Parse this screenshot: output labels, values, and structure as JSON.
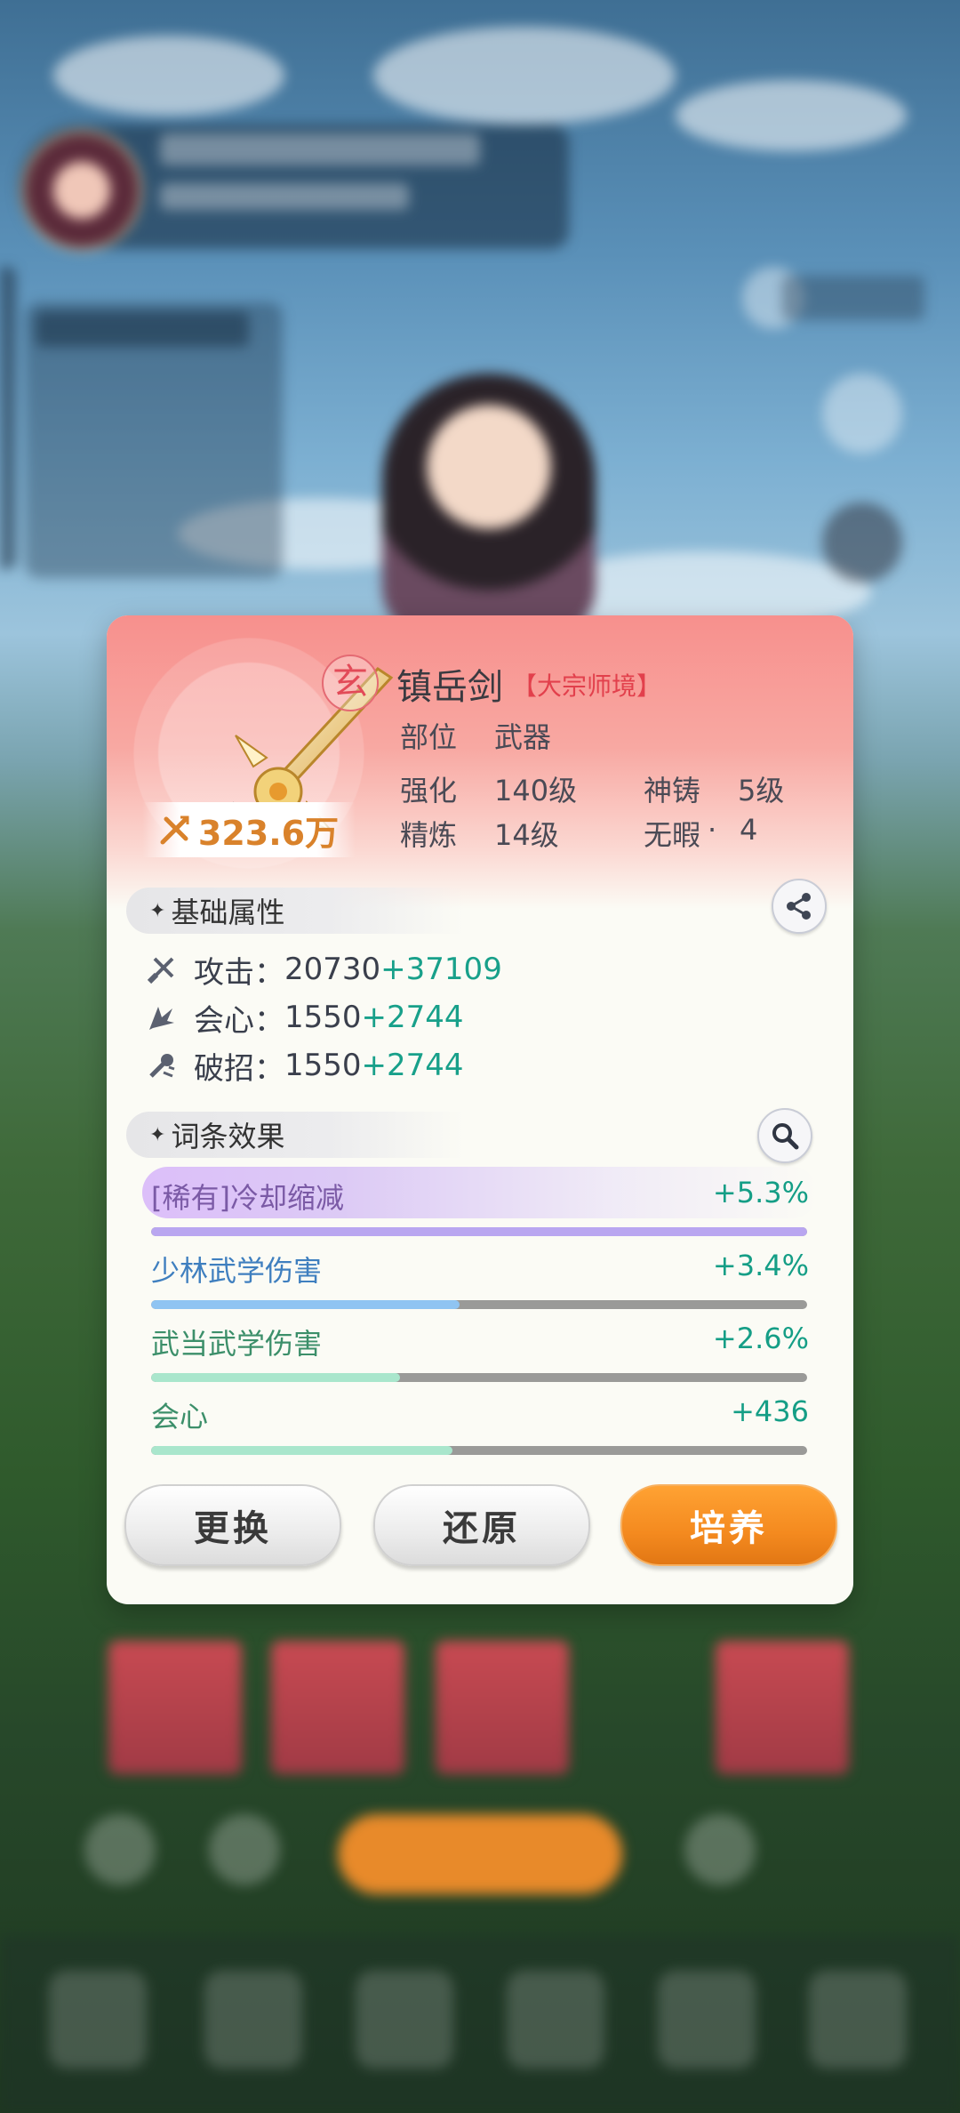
{
  "equipment": {
    "name": "镇岳剑",
    "realm_tag": "【大宗师境】",
    "rank_badge": "玄",
    "power": "323.6万",
    "slot_label": "部位",
    "slot_value": "武器",
    "enhance_label": "强化",
    "enhance_value": "140级",
    "forge_label": "神铸",
    "forge_value": "5级",
    "refine_label": "精炼",
    "refine_value": "14级",
    "flawless_label": "无暇",
    "flawless_value": "4"
  },
  "base_attributes": {
    "title": "基础属性",
    "stats": [
      {
        "name": "攻击",
        "base": "20730",
        "bonus": "+37109"
      },
      {
        "name": "会心",
        "base": "1550",
        "bonus": "+2744"
      },
      {
        "name": "破招",
        "base": "1550",
        "bonus": "+2744"
      }
    ]
  },
  "affix_effects": {
    "title": "词条效果",
    "items": [
      {
        "name": "[稀有]冷却缩减",
        "value": "+5.3%",
        "fill": 1.0,
        "color": "#7b5aa6",
        "bar_color": "#b9a6f0"
      },
      {
        "name": "少林武学伤害",
        "value": "+3.4%",
        "fill": 0.47,
        "color": "#3f7fbf",
        "bar_color": "#8fc4f2"
      },
      {
        "name": "武当武学伤害",
        "value": "+2.6%",
        "fill": 0.38,
        "color": "#3c8f6a",
        "bar_color": "#a9e6cc"
      },
      {
        "name": "会心",
        "value": "+436",
        "fill": 0.46,
        "color": "#3c8f6a",
        "bar_color": "#a9e6cc"
      }
    ]
  },
  "buttons": {
    "replace": "更换",
    "restore": "还原",
    "cultivate": "培养"
  }
}
